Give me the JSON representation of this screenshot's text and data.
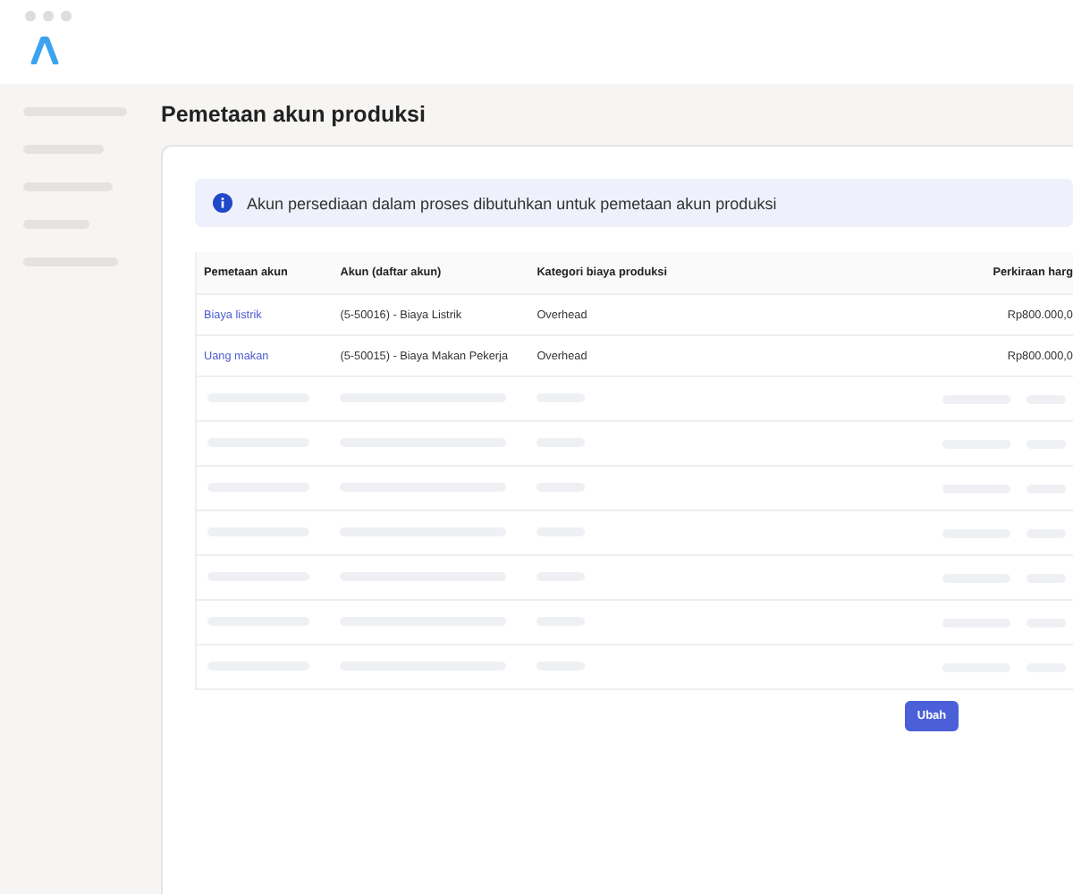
{
  "page": {
    "title": "Pemetaan akun produksi"
  },
  "alert": {
    "text": "Akun persediaan dalam proses dibutuhkan untuk pemetaan akun produksi"
  },
  "table": {
    "columns": [
      "Pemetaan akun",
      "Akun (daftar akun)",
      "Kategori biaya produksi",
      "Perkiraan harg"
    ],
    "rows": [
      {
        "mapping": "Biaya listrik",
        "account": "(5-50016) - Biaya Listrik",
        "category": "Overhead",
        "estimate": "Rp800.000,0"
      },
      {
        "mapping": "Uang makan",
        "account": "(5-50015) - Biaya Makan Pekerja",
        "category": "Overhead",
        "estimate": "Rp800.000,0"
      }
    ]
  },
  "button": {
    "label": "Ubah"
  }
}
